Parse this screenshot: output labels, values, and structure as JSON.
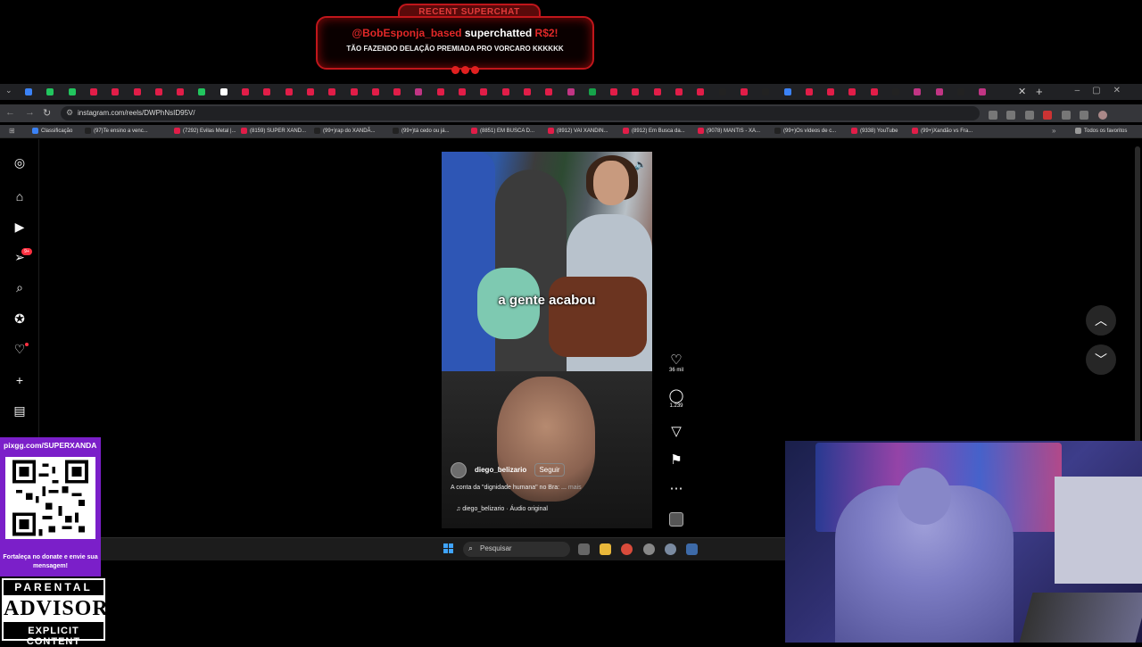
{
  "superchat": {
    "tab_title": "RECENT SUPERCHAT",
    "user": "@BobEsponja_based",
    "action": "superchatted",
    "amount": "R$2!",
    "message": "TÃO FAZENDO DELAÇÃO PREMIADA PRO VORCARO KKKKKK"
  },
  "browser": {
    "url": "instagram.com/reels/DWPhNsID95V/",
    "bookmarks": [
      "Classificação",
      "(97)Te ensino a venc...",
      "(7292) Evilas Metal |...",
      "(8159) SUPER XAND...",
      "(99+)rap do XANDÃ...",
      "(99+)tá cedo ou já...",
      "(8851) EM BUSCA D...",
      "(8912) VAI XANDIN...",
      "(8912) Em Busca da...",
      "(9078) MANTIS - XA...",
      "(99+)Os vídeos de c...",
      "(9338) YouTube",
      "(99+)Xandão vs Fra..."
    ],
    "all_bookmarks": "Todos os favoritos"
  },
  "instagram": {
    "notification_badge": "9+",
    "reel": {
      "caption_overlay": "a gente acabou",
      "author": "diego_belizario",
      "follow_label": "Seguir",
      "description": "A conta da \"dignidade humana\" no Bra: ...",
      "more_label": "mais",
      "audio": "diego_belizario · Áudio original"
    },
    "actions": {
      "likes": "36 mil",
      "comments": "1.239"
    }
  },
  "taskbar": {
    "search_placeholder": "Pesquisar"
  },
  "donation": {
    "url": "pixgg.com/SUPERXANDA",
    "caption": "Fortaleça no donate e envie sua mensagem!"
  },
  "advisory": {
    "top": "PARENTAL",
    "middle": "ADVISORY",
    "bottom": "EXPLICIT CONTENT"
  },
  "colors": {
    "instagram_red": "#ff3040",
    "superchat_red": "#e02828",
    "donation_purple": "#7b1fc9"
  }
}
